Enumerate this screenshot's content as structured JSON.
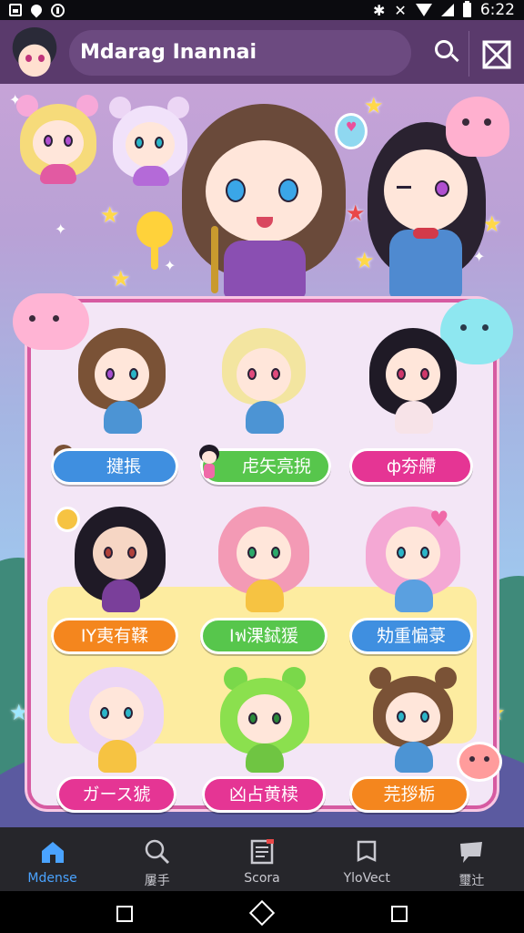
{
  "status_bar": {
    "time": "6:22"
  },
  "app_bar": {
    "title": "Mdarag Inannai"
  },
  "cards": [
    {
      "name": "揵掁",
      "color": "blue"
    },
    {
      "name": "虍矢亮掜",
      "color": "green"
    },
    {
      "name": "ф夯艜",
      "color": "pink"
    },
    {
      "name": "ΙΥ夷有鞣",
      "color": "orange"
    },
    {
      "name": "Ιฟ淉鋱猨",
      "color": "green"
    },
    {
      "name": "劮重惼菉",
      "color": "blue"
    },
    {
      "name": "ガース猇",
      "color": "pink"
    },
    {
      "name": "凶占黄椟",
      "color": "pink"
    },
    {
      "name": "芫拶栃",
      "color": "orange"
    }
  ],
  "bottom_nav": [
    {
      "label": "Mdense",
      "icon": "home-icon",
      "active": true
    },
    {
      "label": "屢手",
      "icon": "search-icon",
      "active": false
    },
    {
      "label": "Scora",
      "icon": "list-icon",
      "active": false
    },
    {
      "label": "YloVect",
      "icon": "book-icon",
      "active": false
    },
    {
      "label": "璽辻",
      "icon": "chat-icon",
      "active": false
    }
  ],
  "colors": {
    "app_bar": "#5a3a6c",
    "active_nav": "#4aa3ff",
    "panel_border": "#d65ba1"
  }
}
